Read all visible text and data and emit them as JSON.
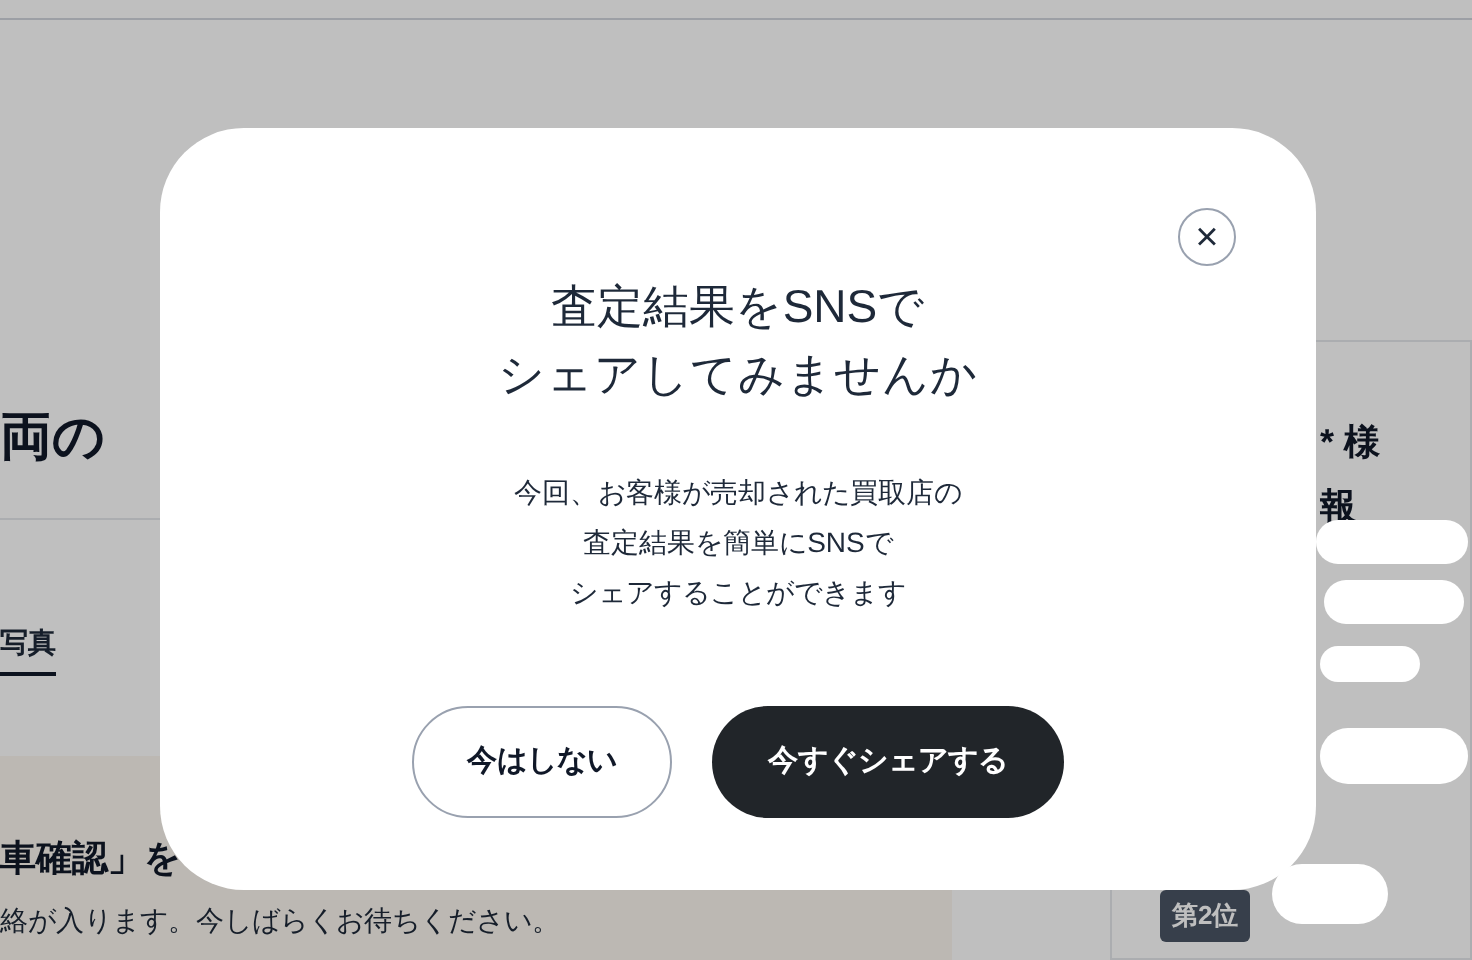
{
  "page": {
    "heading": "両の",
    "tabs": [
      {
        "label": "写真",
        "selected": true
      }
    ],
    "notice": {
      "title": "車確認」を",
      "body": "絡が入ります。今しばらくお待ちください。"
    },
    "side_panel": {
      "lines": [
        "* 様",
        "報"
      ],
      "rank_badge": "第2位"
    }
  },
  "modal": {
    "title_lines": [
      "査定結果をSNSで",
      "シェアしてみませんか"
    ],
    "body_lines": [
      "今回、お客様が売却された買取店の",
      "査定結果を簡単にSNSで",
      "シェアすることができます"
    ],
    "close": "×",
    "buttons": [
      {
        "label": "今はしない",
        "kind": "secondary"
      },
      {
        "label": "今すぐシェアする",
        "kind": "primary"
      }
    ]
  }
}
